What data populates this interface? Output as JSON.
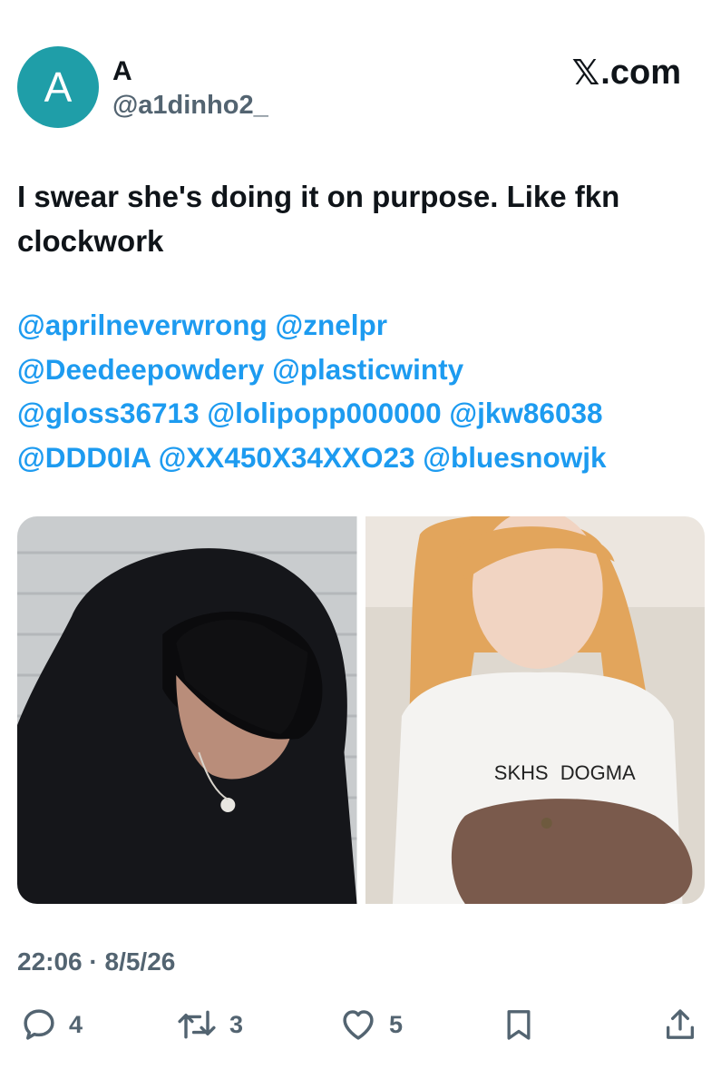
{
  "author": {
    "avatar_initial": "A",
    "display_name": "A",
    "handle": "@a1dinho2_"
  },
  "brand": {
    "mark": "𝕏",
    "text": ".com"
  },
  "tweet": {
    "text": "I swear she's doing it on purpose. Like fkn clockwork",
    "mentions": [
      "@aprilneverwrong",
      "@znelpr",
      "@Deedeepowdery",
      "@plasticwinty",
      "@gloss36713",
      "@lolipopp000000",
      "@jkw86038",
      "@DDD0IA",
      "@XX450X34XXO23",
      "@bluesnowjk"
    ],
    "timestamp": "22:06 · 8/5/26"
  },
  "media": [
    {
      "name": "photo-left",
      "icon": "person-photo"
    },
    {
      "name": "photo-right",
      "icon": "person-photo"
    }
  ],
  "actions": {
    "reply_count": "4",
    "retweet_count": "3",
    "like_count": "5"
  },
  "colors": {
    "avatar_bg": "#1f9ea8",
    "mention_blue": "#1d9bf0",
    "meta_grey": "#536471"
  }
}
